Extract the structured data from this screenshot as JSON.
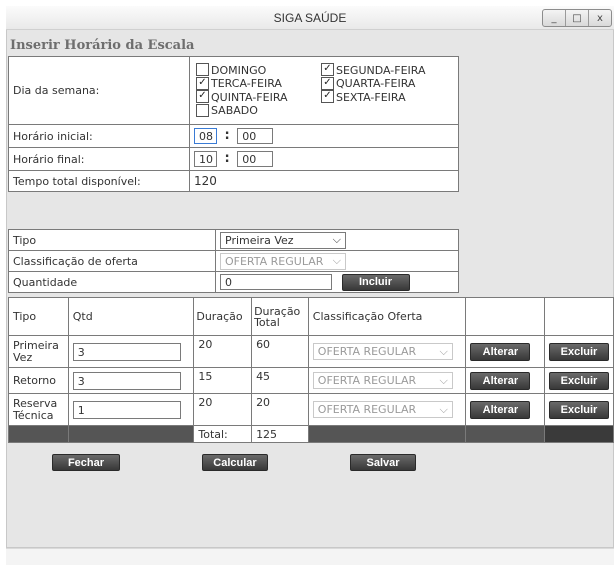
{
  "window": {
    "title": "SIGA SAÚDE",
    "controls": {
      "minimize": "_",
      "maximize": "□",
      "close": "x"
    }
  },
  "heading": "Inserir Horário da Escala",
  "schedule": {
    "day_label": "Dia da semana:",
    "days": [
      {
        "label": "DOMINGO",
        "checked": false
      },
      {
        "label": "SEGUNDA-FEIRA",
        "checked": true
      },
      {
        "label": "TERCA-FEIRA",
        "checked": true
      },
      {
        "label": "QUARTA-FEIRA",
        "checked": true
      },
      {
        "label": "QUINTA-FEIRA",
        "checked": true
      },
      {
        "label": "SEXTA-FEIRA",
        "checked": true
      },
      {
        "label": "SABADO",
        "checked": false
      }
    ],
    "start_label": "Horário inicial:",
    "start_hour": "08",
    "start_min": "00",
    "end_label": "Horário final:",
    "end_hour": "10",
    "end_min": "00",
    "separator": ":",
    "total_label": "Tempo total disponível:",
    "total_value": "120"
  },
  "form": {
    "type_label": "Tipo",
    "type_value": "Primeira Vez",
    "class_label": "Classificação de oferta",
    "class_value": "OFERTA REGULAR",
    "qty_label": "Quantidade",
    "qty_value": "0",
    "include_button": "Incluir"
  },
  "grid": {
    "headers": [
      "Tipo",
      "Qtd",
      "Duração",
      "Duração Total",
      "Classificação Oferta"
    ],
    "rows": [
      {
        "tipo": "Primeira Vez",
        "qtd": "3",
        "duracao": "20",
        "total": "60",
        "classificacao": "OFERTA REGULAR"
      },
      {
        "tipo": "Retorno",
        "qtd": "3",
        "duracao": "15",
        "total": "45",
        "classificacao": "OFERTA REGULAR"
      },
      {
        "tipo": "Reserva Técnica",
        "qtd": "1",
        "duracao": "20",
        "total": "20",
        "classificacao": "OFERTA REGULAR"
      }
    ],
    "alter_button": "Alterar",
    "delete_button": "Excluir",
    "footer_label": "Total:",
    "footer_value": "125"
  },
  "actions": {
    "close": "Fechar",
    "calculate": "Calcular",
    "save": "Salvar"
  }
}
